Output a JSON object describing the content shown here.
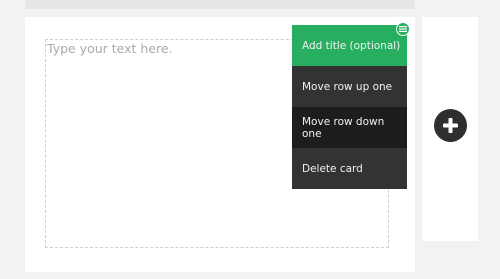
{
  "editor": {
    "placeholder": "Type your text here."
  },
  "card_menu": {
    "items": [
      {
        "label": "Add title (optional)"
      },
      {
        "label": "Move row up one"
      },
      {
        "label": "Move row down one"
      },
      {
        "label": "Delete card"
      }
    ]
  },
  "icons": {
    "menu_toggle": "hamburger-icon",
    "add_card": "plus-icon"
  },
  "colors": {
    "accent": "#27ae60",
    "menu_background": "#333333",
    "menu_hover": "#1d1d1d",
    "add_button": "#2f2f2f"
  }
}
